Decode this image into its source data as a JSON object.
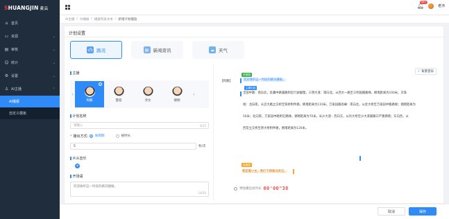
{
  "brand": {
    "logo_text": "HUANGJIN",
    "logo_prefix": "S",
    "suffix": "麦云"
  },
  "sidebar": {
    "items": [
      {
        "label": "首页",
        "icon": "home-icon"
      },
      {
        "label": "资源",
        "icon": "folder-icon"
      },
      {
        "label": "审核",
        "icon": "audit-icon"
      },
      {
        "label": "统计",
        "icon": "user-icon"
      },
      {
        "label": "设置",
        "icon": "gear-icon"
      },
      {
        "label": "AI主播",
        "icon": "robot-icon"
      }
    ],
    "sub_items": [
      {
        "label": "AI播报",
        "active": true
      },
      {
        "label": "自定义模板",
        "active": false
      }
    ]
  },
  "header": {
    "notifications": "99+",
    "user_name": "老沛"
  },
  "breadcrumb": [
    "AI主播",
    "AI播报",
    "播报列表文本",
    "新增计划播放"
  ],
  "main": {
    "section_title": "计划设置",
    "tabs": [
      {
        "label": "路况",
        "icon": "car-icon",
        "active": true
      },
      {
        "label": "新闻资讯",
        "icon": "news-icon",
        "active": false
      },
      {
        "label": "天气",
        "icon": "weather-icon",
        "active": false
      }
    ],
    "form": {
      "anchor_label": "主播",
      "anchors": [
        {
          "name": "和鹏",
          "active": true
        },
        {
          "name": "慧蓓",
          "active": false
        },
        {
          "name": "淳文",
          "active": false
        },
        {
          "name": "德明",
          "active": false
        }
      ],
      "plan_name_label": "计划名称",
      "plan_name_placeholder": "请输入",
      "plan_name_counter": "0/15",
      "play_mode_label": "播出方式：",
      "play_mode_options": [
        {
          "label": "按周期",
          "selected": true
        },
        {
          "label": "按时长",
          "selected": false
        }
      ],
      "interval_value": "5",
      "interval_unit": "秒/次",
      "intro_music_label": "片头音乐",
      "opening_label": "开场语",
      "opening_text": "欢迎收听这一时段的路况播报。",
      "opening_counter": "14/50"
    },
    "preview": {
      "bgm_label": "背景音乐",
      "title": "【和鹏】",
      "tag_opening": "开场语",
      "opening_line": "欢迎收听这一时段的路况播报。",
      "tag_main": "主要内容",
      "content_lines": [
        "全国中路：南向北，金藏中路辅路附近行驶缓慢，三明大道：南向北，从西大一路至三明国路路缘，拥堵距离为100米。京珠",
        "线：北向南，从迈大路立交桥至铁桥附件路，拥堵距离为110米。万家园路高峰：南向北，从金大桥至万家园中路路缘；拥堵距离为",
        "50米；北向南，万家园中路附近路缘，拥堵距离为70米。长沙大道：西向东，从肖大桥至沙大道辅路口严重拥堵；东向西，从",
        "西花立交桥至肃大桥附件路，拥堵距离为120米。"
      ],
      "tag_closing": "结束语",
      "closing_line": "我是鑫小主，我们下期路况再见。",
      "duration_label": "预估播出总时长",
      "duration_value": "00'00\"38"
    }
  },
  "footer": {
    "cancel_label": "取消",
    "save_label": "保存"
  }
}
